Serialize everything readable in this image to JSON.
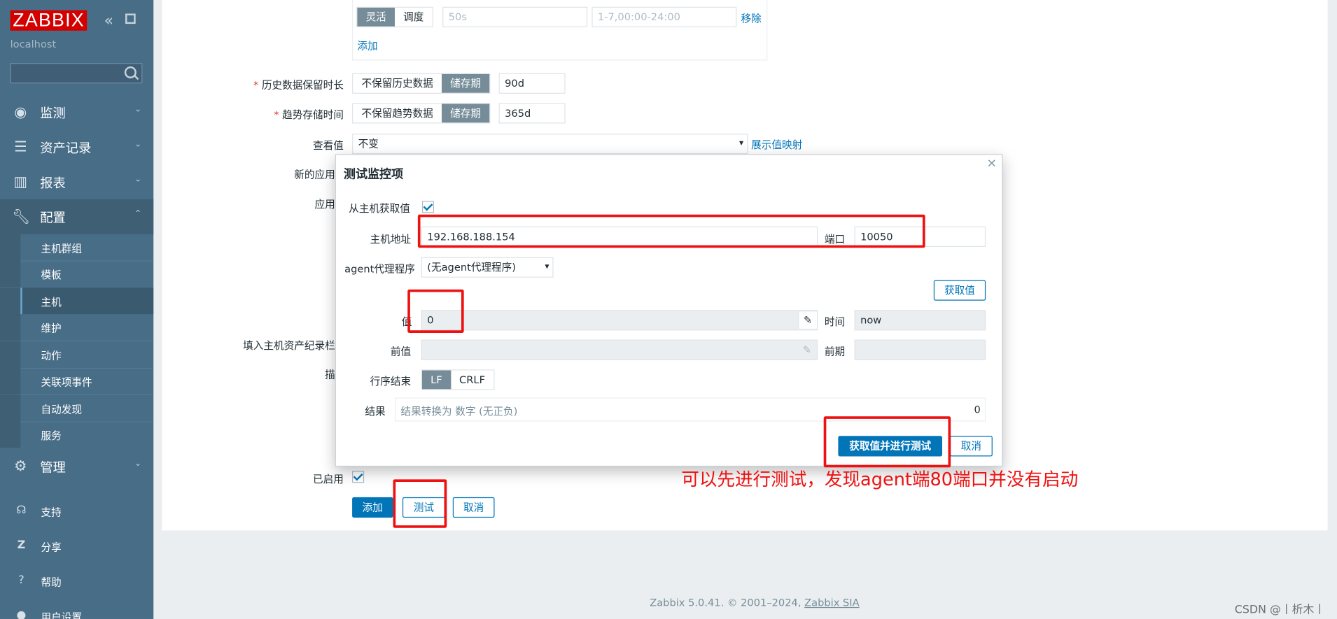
{
  "sidebar": {
    "logo": "ZABBIX",
    "host": "localhost",
    "search_placeholder": "",
    "main_items": [
      {
        "label": "监测"
      },
      {
        "label": "资产记录"
      },
      {
        "label": "报表"
      },
      {
        "label": "配置"
      },
      {
        "label": "管理"
      }
    ],
    "config_sub_items": [
      {
        "label": "主机群组"
      },
      {
        "label": "模板"
      },
      {
        "label": "主机"
      },
      {
        "label": "维护"
      },
      {
        "label": "动作"
      },
      {
        "label": "关联项事件"
      },
      {
        "label": "自动发现"
      },
      {
        "label": "服务"
      }
    ],
    "bottom_items": [
      {
        "label": "支持"
      },
      {
        "label": "分享"
      },
      {
        "label": "帮助"
      },
      {
        "label": "用户设置"
      }
    ]
  },
  "form": {
    "interval_type_options": [
      "灵活",
      "调度"
    ],
    "interval_placeholder": "50s",
    "period_placeholder": "1-7,00:00-24:00",
    "remove_link": "移除",
    "add_link": "添加",
    "history_label": "历史数据保留时长",
    "history_options": [
      "不保留历史数据",
      "储存期"
    ],
    "history_value": "90d",
    "trends_label": "趋势存储时间",
    "trends_options": [
      "不保留趋势数据",
      "储存期"
    ],
    "trends_value": "365d",
    "show_value_label": "查看值",
    "show_value_selected": "不变",
    "show_value_mapping_link": "展示值映射",
    "new_app_label": "新的应用",
    "app_label": "应用",
    "inventory_label": "填入主机资产纪录栏",
    "desc_label": "描",
    "enabled_label": "已启用",
    "btn_add": "添加",
    "btn_test": "测试",
    "btn_cancel": "取消"
  },
  "dialog": {
    "title": "测试监控项",
    "get_from_host_label": "从主机获取值",
    "host_addr_label": "主机地址",
    "host_addr_value": "192.168.188.154",
    "port_label": "端口",
    "port_value": "10050",
    "proxy_label": "agent代理程序",
    "proxy_selected": "(无agent代理程序)",
    "get_value_button": "获取值",
    "value_label": "值",
    "value_value": "0",
    "time_label": "时间",
    "time_value": "now",
    "prev_value_label": "前值",
    "prev_time_label": "前期",
    "eol_label": "行序结束",
    "eol_options": [
      "LF",
      "CRLF"
    ],
    "result_label": "结果",
    "result_text": "结果转换为 数字 (无正负)",
    "result_value": "0",
    "btn_get_and_test": "获取值并进行测试",
    "btn_cancel": "取消"
  },
  "annotation": "可以先进行测试，发现agent端80端口并没有启动",
  "footer": {
    "text": "Zabbix 5.0.41. © 2001–2024, ",
    "link": "Zabbix SIA"
  },
  "watermark": "CSDN @丨析木丨"
}
